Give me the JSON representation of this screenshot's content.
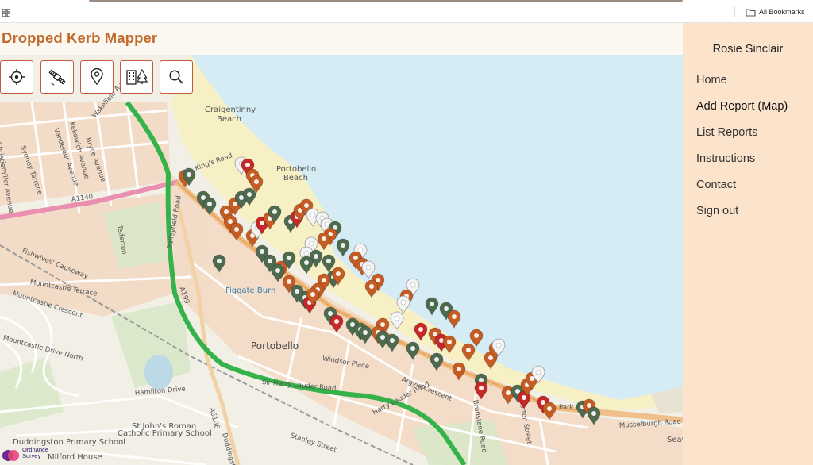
{
  "browser": {
    "bookmarks_label": "All Bookmarks",
    "apps_icon": "apps-grid-icon",
    "folder_icon": "folder-icon"
  },
  "app": {
    "title": "Dropped Kerb Mapper"
  },
  "toolbar": {
    "buttons": [
      {
        "name": "locate-button",
        "icon": "crosshair-icon"
      },
      {
        "name": "satellite-button",
        "icon": "satellite-icon"
      },
      {
        "name": "pin-button",
        "icon": "map-pin-icon"
      },
      {
        "name": "amenities-button",
        "icon": "building-tree-icon"
      },
      {
        "name": "search-button",
        "icon": "search-icon"
      }
    ]
  },
  "sidebar": {
    "user": "Rosie Sinclair",
    "items": [
      {
        "label": "Home"
      },
      {
        "label": "Add Report (Map)"
      },
      {
        "label": "List Reports"
      },
      {
        "label": "Instructions"
      },
      {
        "label": "Contact"
      },
      {
        "label": "Sign out"
      }
    ]
  },
  "map": {
    "labels": {
      "craigentinny": "Craigentinny",
      "craigentinny_beach": "Beach",
      "portobello_beach_1": "Portobello",
      "portobello_beach_2": "Beach",
      "portobello": "Portobello",
      "figgate_burn": "Figgate Burn",
      "st_johns_1": "St John's Roman",
      "st_johns_2": "Catholic Primary School",
      "duddingston_school": "Duddingston Primary School",
      "milford_house": "Milford House",
      "kings_road": "King's Road",
      "a1140": "A1140",
      "a199": "A199",
      "sir_harry_lauder": "Sir Harry Lauder Road",
      "musselburgh": "Musselburgh Road",
      "seav": "Seav",
      "eishwives": "Fishwives' Causeway",
      "mountcastle_crescent": "Mountcastle Crescent",
      "mountcastle_terrace": "Mountcastle Terrace",
      "mountcastle_drive": "Mountcastle Drive North",
      "hamilton_drive": "Hamilton Drive",
      "argyle_crescent": "Argyle Crescent",
      "brunstane_road": "Brunstane Road",
      "stanley_street": "Stanley Street",
      "windsor_place": "Windsor Place",
      "harry_lauder": "Harry Lauder Road",
      "baileyfield": "Baileyfield Road",
      "wakefield": "Wakefield Avenue",
      "vandeleur": "Vandeleur Avenue",
      "sydney": "Sydney Terrace",
      "bryce": "Bryce Avenue",
      "ernstemiller": "Christiemiller Avenue",
      "kekewich": "Kekewich Avenue",
      "telferton": "Telferton",
      "a6106": "A6106",
      "moira": "Morton Street",
      "park": "Park",
      "duddingston_road": "Duddingston"
    },
    "os_attribution_1": "Ordnance",
    "os_attribution_2": "Survey"
  },
  "colors": {
    "accent": "#c06a2c",
    "pin_orange": "#c45c24",
    "pin_green": "#4e6b4f",
    "pin_red": "#c62828",
    "pin_white": "#f4f4f4",
    "sea": "#d6ecf4",
    "sand": "#f6f0c8",
    "sidebar_bg": "#fbe3cc"
  }
}
